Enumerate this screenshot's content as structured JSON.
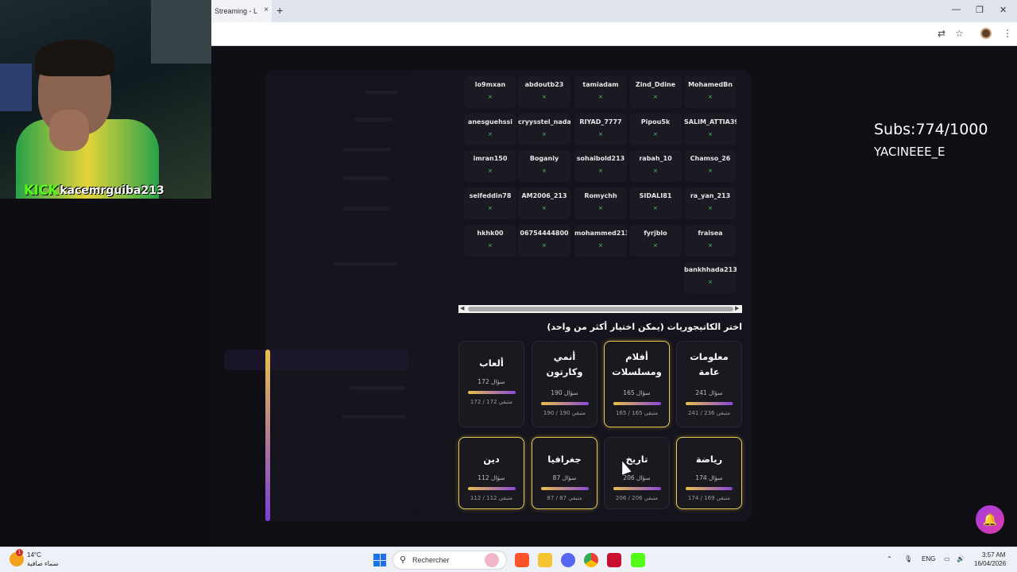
{
  "browser": {
    "tab_title": "Streaming - L",
    "tab_close": "×",
    "new_tab": "+",
    "minimize": "—",
    "restore": "❐",
    "close": "✕"
  },
  "stream_overlay": {
    "kick_logo": "KICK",
    "kick_username": "kacemrguiba213",
    "subs": "Subs:774/1000",
    "subs_user": "YACINEEE_E"
  },
  "users": [
    [
      "lo9mxan",
      "abdoutb23",
      "tamiadam",
      "Zind_Ddine",
      "MohamedBn"
    ],
    [
      "anesguehssi",
      "cryysstel_nada1",
      "RIYAD_7777",
      "Pipou5k",
      "SALIM_ATTIA39"
    ],
    [
      "imran150",
      "Boganiy",
      "sohaibold213",
      "rabah_10",
      "Chamso_26"
    ],
    [
      "seifeddin78",
      "AM2006_213",
      "Romychh",
      "SIDALI81",
      "ra_yan_213"
    ],
    [
      "hkhk00",
      "06754444800",
      "mohammed213J",
      "fyrjblo",
      "fraisea"
    ],
    [
      "",
      "",
      "",
      "",
      "bankhhada213"
    ]
  ],
  "categories_heading": "اختر الكاتيجوريات (يمكن اختيار أكثر من واحد)",
  "categories": [
    {
      "title_lines": [
        "معلومات",
        "عامة"
      ],
      "count": "241 سؤال",
      "remaining": "متبقي 236 / 241",
      "fill": 0.98,
      "selected": false
    },
    {
      "title_lines": [
        "أفلام",
        "ومسلسلات"
      ],
      "count": "165 سؤال",
      "remaining": "متبقي 165 / 165",
      "fill": 1.0,
      "selected": true
    },
    {
      "title_lines": [
        "أنمي",
        "وكارتون"
      ],
      "count": "190 سؤال",
      "remaining": "متبقي 190 / 190",
      "fill": 1.0,
      "selected": false
    },
    {
      "title_lines": [
        "ألعاب"
      ],
      "count": "172 سؤال",
      "remaining": "متبقي 172 / 172",
      "fill": 1.0,
      "selected": false
    },
    {
      "title_lines": [
        "رياضة"
      ],
      "count": "174 سؤال",
      "remaining": "متبقي 169 / 174",
      "fill": 0.97,
      "selected": true
    },
    {
      "title_lines": [
        "تاريخ"
      ],
      "count": "206 سؤال",
      "remaining": "متبقي 206 / 206",
      "fill": 1.0,
      "selected": false
    },
    {
      "title_lines": [
        "جغرافيا"
      ],
      "count": "87 سؤال",
      "remaining": "متبقي 87 / 87",
      "fill": 1.0,
      "selected": true
    },
    {
      "title_lines": [
        "دين"
      ],
      "count": "112 سؤال",
      "remaining": "متبقي 112 / 112",
      "fill": 1.0,
      "selected": true
    }
  ],
  "fab_icon": "bell-icon",
  "taskbar": {
    "notif_count": "1",
    "temperature": "14°C",
    "weather": "سماء صافية",
    "search_label": "Rechercher",
    "lang": "ENG",
    "time": "3:57 AM",
    "date": "16/04/2026"
  }
}
